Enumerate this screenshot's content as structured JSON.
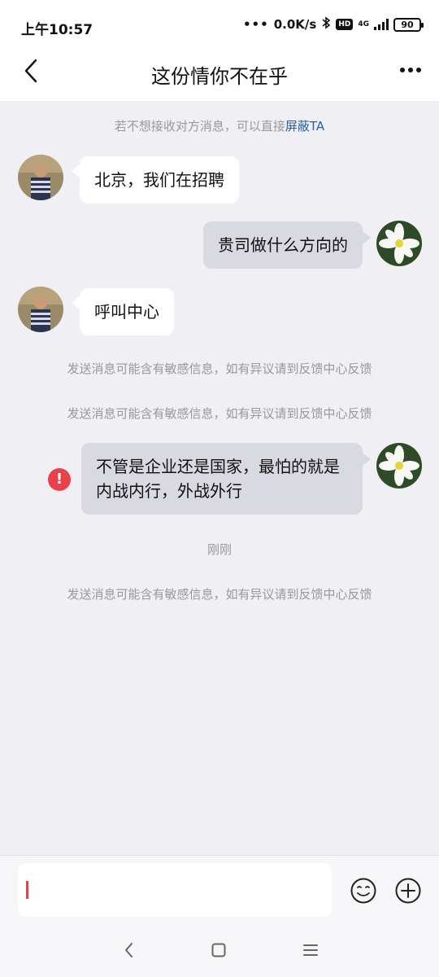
{
  "status_bar": {
    "time": "上午10:57",
    "speed": "0.0K/s",
    "hd": "HD",
    "network": "4G",
    "battery": "90"
  },
  "header": {
    "title": "这份情你不在乎"
  },
  "chat": {
    "block_notice_prefix": "若不想接收对方消息，可以直接",
    "block_notice_link": "屏蔽TA",
    "messages": [
      {
        "side": "in",
        "text": "北京，我们在招聘"
      },
      {
        "side": "out",
        "text": "贵司做什么方向的"
      },
      {
        "side": "in",
        "text": "呼叫中心"
      },
      {
        "side": "out",
        "text": "不管是企业还是国家，最怕的就是内战内行，外战外行",
        "failed": true
      }
    ],
    "system_notices": [
      "发送消息可能含有敏感信息，如有异议请到反馈中心反馈",
      "发送消息可能含有敏感信息，如有异议请到反馈中心反馈",
      "发送消息可能含有敏感信息，如有异议请到反馈中心反馈"
    ],
    "timestamp": "刚刚",
    "error_mark": "!"
  },
  "input": {
    "value": ""
  },
  "colors": {
    "error": "#e8414a",
    "link": "#2d5fa0",
    "outgoing_bubble": "#d9d9e1",
    "background": "#efeff4"
  }
}
